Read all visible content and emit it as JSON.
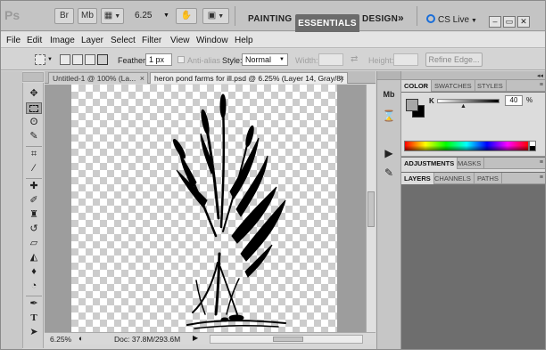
{
  "appbar": {
    "logo": "Ps",
    "btn_bridge": "Br",
    "btn_minibridge": "Mb",
    "zoom": "6.25",
    "workspaces": {
      "painting": "PAINTING",
      "essentials": "ESSENTIALS",
      "design": "DESIGN",
      "more": "»"
    },
    "cs_live": "CS Live",
    "win_min": "–",
    "win_max": "▭",
    "win_close": "✕"
  },
  "menu": [
    "File",
    "Edit",
    "Image",
    "Layer",
    "Select",
    "Filter",
    "View",
    "Window",
    "Help"
  ],
  "options": {
    "feather_label": "Feather:",
    "feather_value": "1 px",
    "antialias_label": "Anti-alias",
    "style_label": "Style:",
    "style_value": "Normal",
    "width_label": "Width:",
    "height_label": "Height:",
    "refine_edge": "Refine Edge..."
  },
  "doc_tabs": [
    {
      "label": "Untitled-1 @ 100% (La...",
      "close": "×"
    },
    {
      "label": "heron pond farms for ill.psd @ 6.25% (Layer 14, Gray/8)",
      "close": "×"
    }
  ],
  "status": {
    "zoom": "6.25%",
    "doc": "Doc: 37.8M/293.6M",
    "arrow": "▶"
  },
  "panels": {
    "color_tabs": [
      "COLOR",
      "SWATCHES",
      "STYLES"
    ],
    "k_label": "K",
    "k_value": "40",
    "k_unit": "%",
    "adjust_tabs": [
      "ADJUSTMENTS",
      "MASKS"
    ],
    "layer_tabs": [
      "LAYERS",
      "CHANNELS",
      "PATHS"
    ],
    "menu_glyph": "≡",
    "collapse_glyph": "◂◂"
  },
  "colors": {
    "fg": "#a7a7a7",
    "bg": "#000000",
    "active_workspace": "#6b6b6b",
    "cs_live_ring": "#1a6ed8"
  },
  "icons": {
    "toolbox": [
      "move-icon",
      "marquee-icon",
      "lasso-icon",
      "quick-select-icon",
      "crop-icon",
      "eyedropper-icon",
      "healing-brush-icon",
      "brush-icon",
      "clone-stamp-icon",
      "history-brush-icon",
      "eraser-icon",
      "paint-bucket-icon",
      "blur-icon",
      "dodge-icon",
      "pen-icon",
      "type-icon"
    ],
    "strip": [
      "mini-bridge-icon",
      "history-icon",
      "actions-icon",
      "tool-presets-icon"
    ]
  }
}
